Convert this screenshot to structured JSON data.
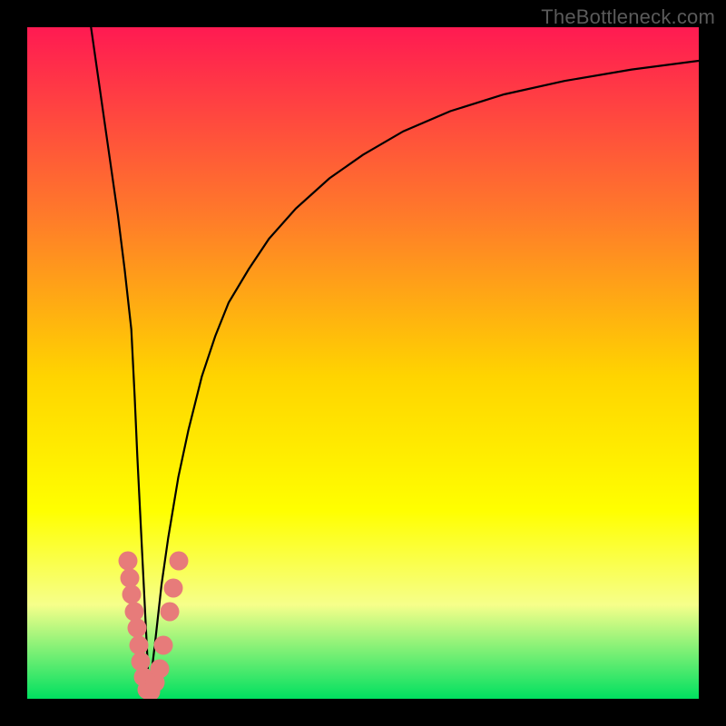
{
  "watermark_text": "TheBottleneck.com",
  "chart_data": {
    "type": "line",
    "title": "",
    "xlabel": "",
    "ylabel": "",
    "xlim": [
      0,
      100
    ],
    "ylim": [
      0,
      100
    ],
    "colors": {
      "gradient_top": "#ff1a52",
      "gradient_mid_upper": "#ff7a2a",
      "gradient_mid": "#ffd400",
      "gradient_mid_lower": "#ffff00",
      "gradient_lower": "#f6ff8a",
      "gradient_bottom": "#00e060",
      "curve": "#000000",
      "marker": "#e77b7a"
    },
    "series": [
      {
        "name": "left-branch",
        "x": [
          9.5,
          10.5,
          11.5,
          12.5,
          13.5,
          14.5,
          15.5,
          16,
          16.4,
          16.8,
          17.2,
          17.6,
          17.9,
          18.1
        ],
        "y": [
          100,
          93,
          86,
          79,
          72,
          64,
          55,
          45,
          36,
          28,
          20,
          12,
          6,
          0.5
        ]
      },
      {
        "name": "right-branch",
        "x": [
          18.1,
          19,
          20,
          21,
          22.5,
          24,
          26,
          28,
          30,
          33,
          36,
          40,
          45,
          50,
          56,
          63,
          71,
          80,
          90,
          100
        ],
        "y": [
          0.5,
          8,
          17,
          24,
          33,
          40,
          48,
          54,
          59,
          64,
          68.5,
          73,
          77.5,
          81,
          84.5,
          87.5,
          90,
          92,
          93.7,
          95
        ]
      }
    ],
    "markers": [
      {
        "x": 15.0,
        "y": 20.5
      },
      {
        "x": 15.3,
        "y": 18.0
      },
      {
        "x": 15.6,
        "y": 15.5
      },
      {
        "x": 16.0,
        "y": 13.0
      },
      {
        "x": 16.3,
        "y": 10.5
      },
      {
        "x": 16.6,
        "y": 8.0
      },
      {
        "x": 16.9,
        "y": 5.5
      },
      {
        "x": 17.3,
        "y": 3.2
      },
      {
        "x": 17.8,
        "y": 1.4
      },
      {
        "x": 18.4,
        "y": 1.1
      },
      {
        "x": 19.1,
        "y": 2.5
      },
      {
        "x": 19.7,
        "y": 4.5
      },
      {
        "x": 20.3,
        "y": 8.0
      },
      {
        "x": 21.2,
        "y": 13.0
      },
      {
        "x": 21.8,
        "y": 16.5
      },
      {
        "x": 22.5,
        "y": 20.5
      }
    ]
  }
}
